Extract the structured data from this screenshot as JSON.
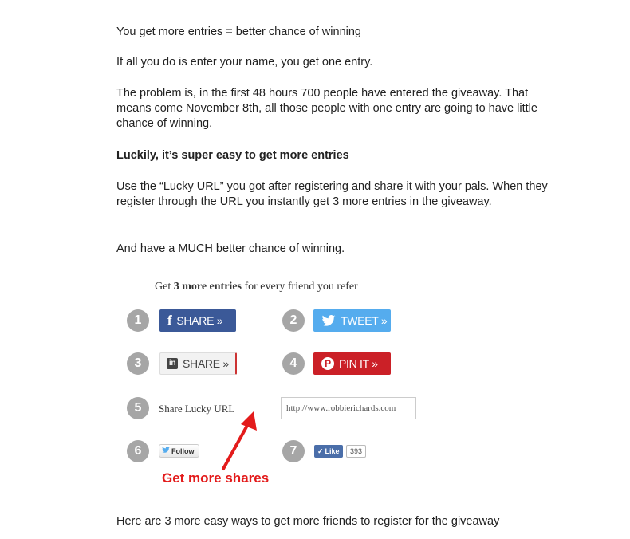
{
  "article": {
    "p1": "You get more entries = better chance of winning",
    "p2": "If all you do is enter your name, you get one entry.",
    "p3": "The problem is, in the first 48 hours 700 people have entered the giveaway. That means come November 8th, all those people with one entry are going to have little chance of winning.",
    "p4": "Luckily, it’s super easy to get more entries",
    "p5": "Use the “Lucky URL” you got after registering and share it with your pals. When they register through the URL you instantly get 3 more entries in the giveaway.",
    "p6": "And have a MUCH better chance of winning.",
    "p7": "Here are 3 more easy ways to get more friends to register for the giveaway"
  },
  "widget": {
    "cta_prefix": "Get ",
    "cta_bold": "3 more entries",
    "cta_suffix": " for every friend you refer",
    "steps": [
      "1",
      "2",
      "3",
      "4",
      "5",
      "6",
      "7"
    ],
    "facebook_label": "SHARE »",
    "twitter_label": "TWEET »",
    "linkedin_label": "SHARE »",
    "linkedin_icon": "in",
    "pinterest_label": "PIN IT »",
    "share_lucky_url_label": "Share Lucky URL",
    "lucky_url_value": "http://www.robbierichards.com",
    "follow_label": "Follow",
    "like_label": "Like",
    "like_count": "393",
    "colors": {
      "facebook": "#3b5998",
      "twitter": "#55acee",
      "pinterest": "#cb2027",
      "annotation": "#e31b1b"
    }
  },
  "annotation": {
    "text": "Get more shares"
  }
}
